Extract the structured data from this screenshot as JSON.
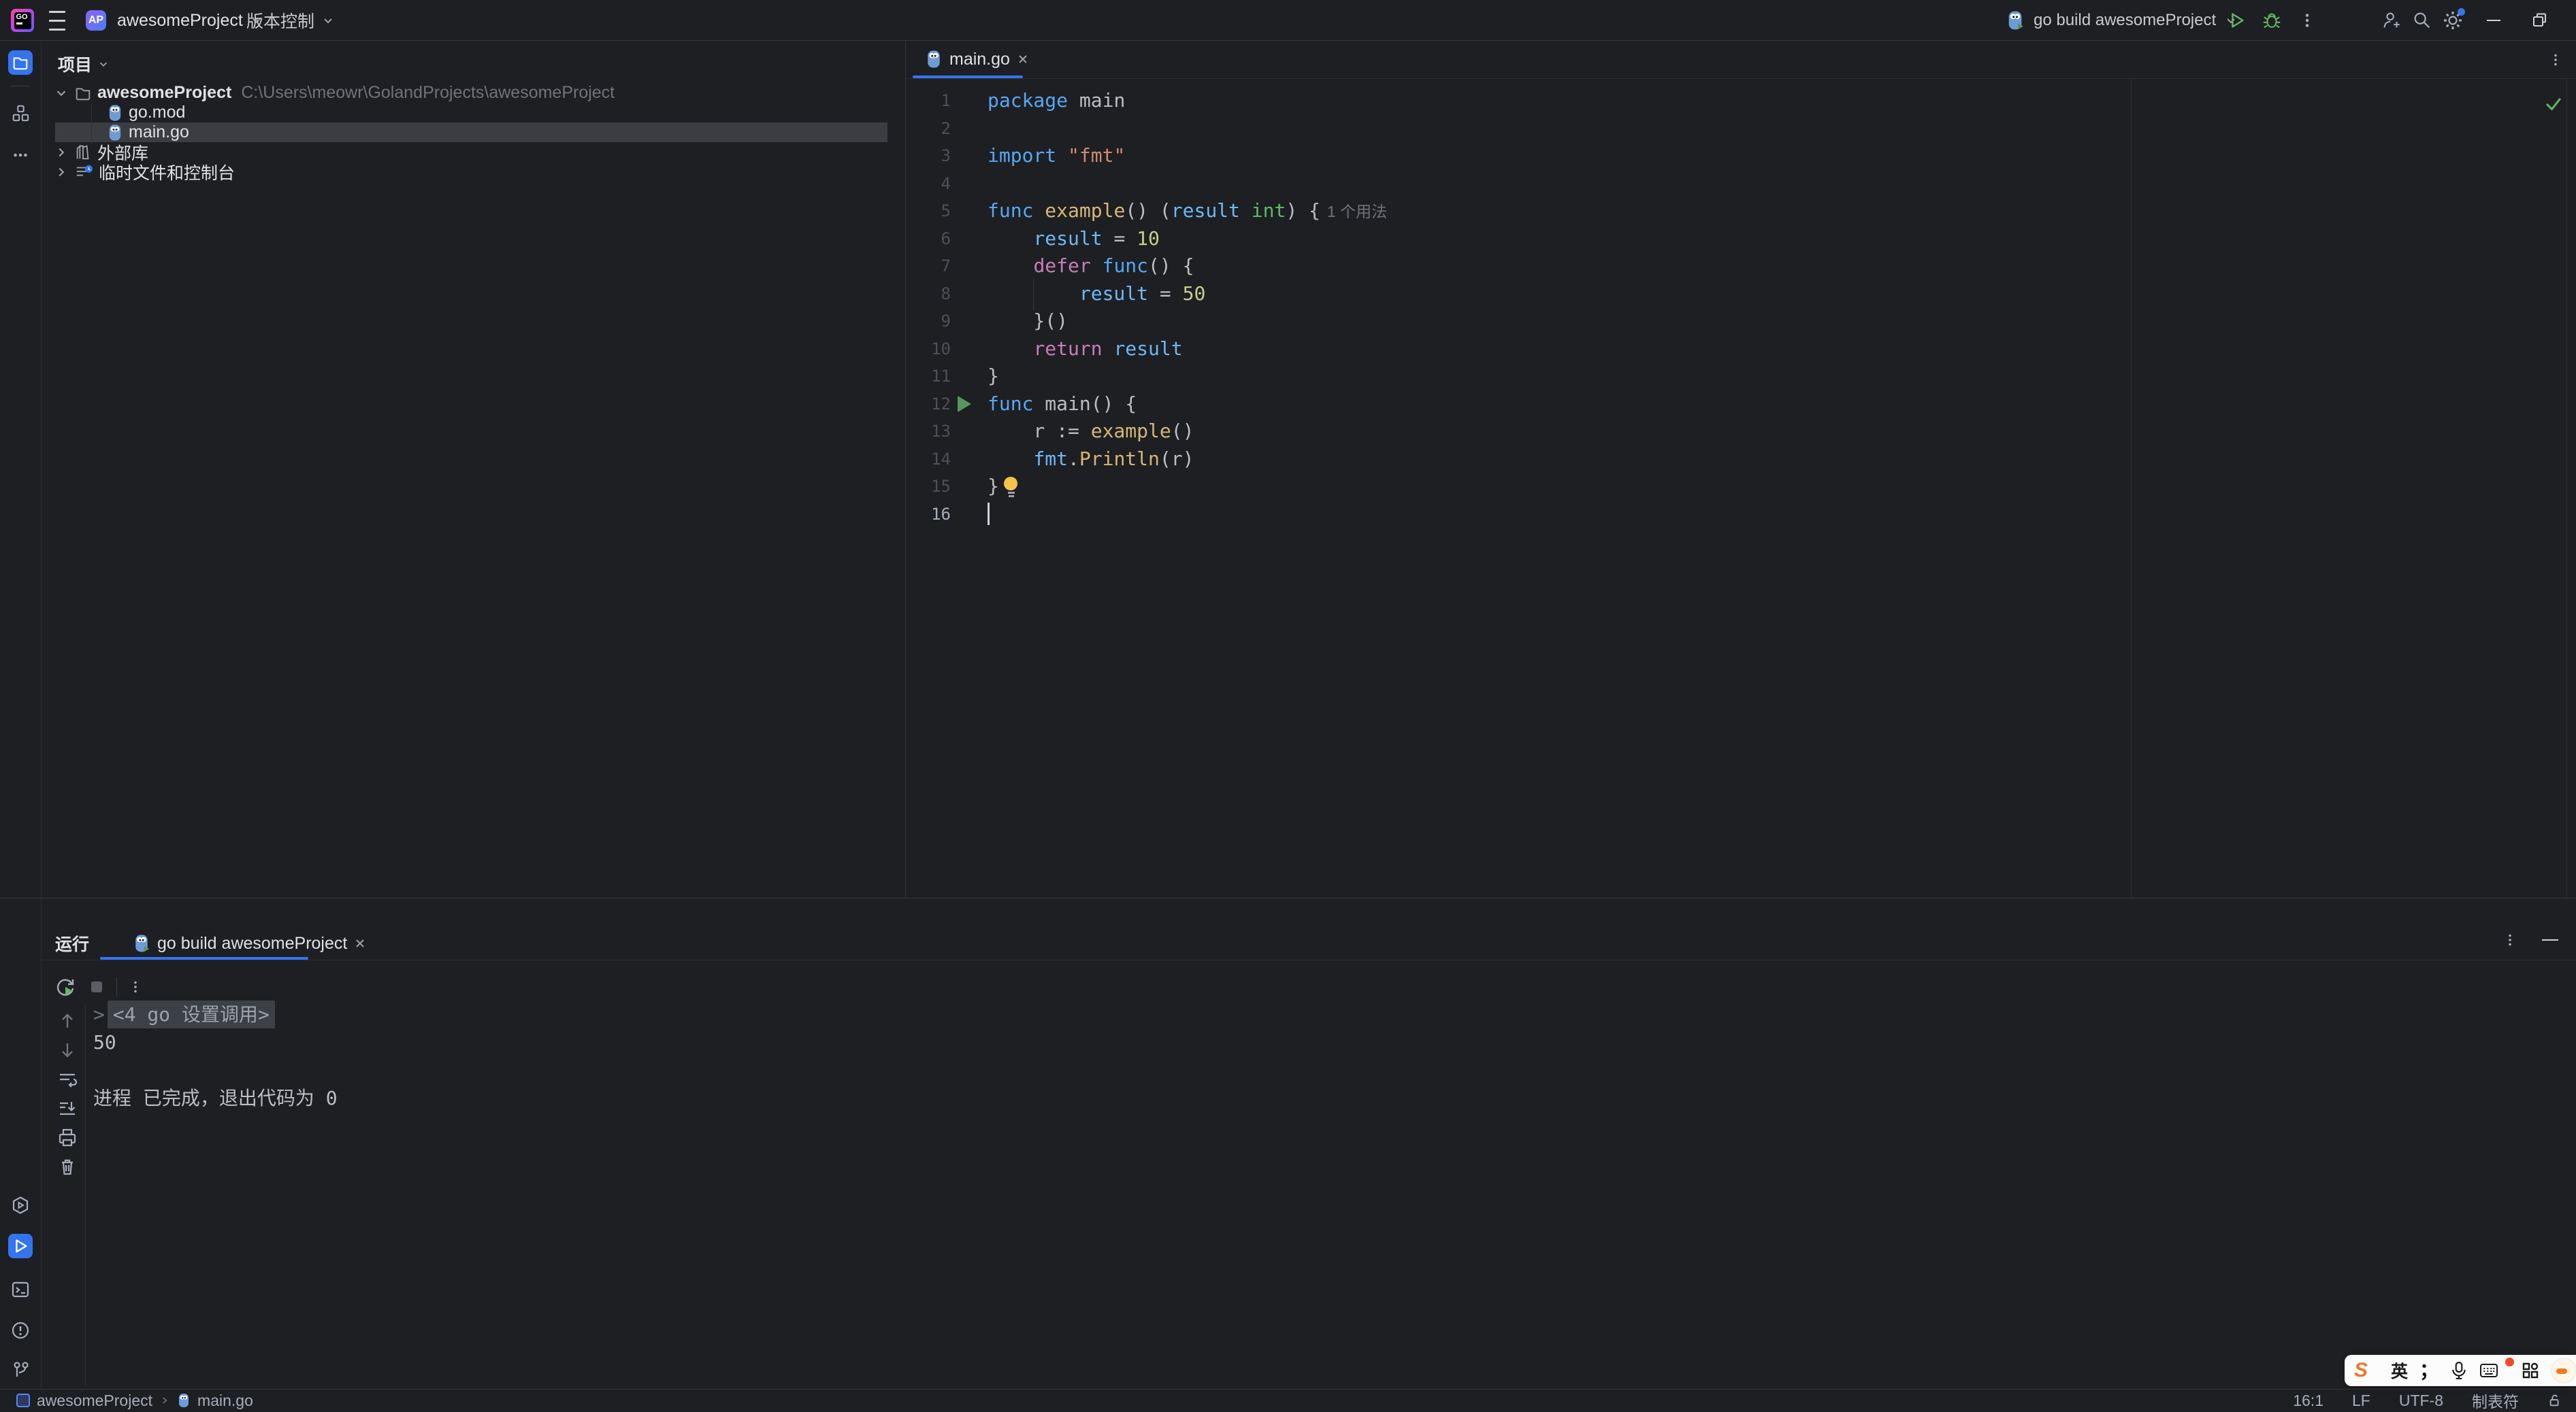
{
  "titlebar": {
    "logo_text": "GO",
    "avatar": "AP",
    "project_name": "awesomeProject",
    "vcs_label": "版本控制",
    "run_config": "go build awesomeProject"
  },
  "project_panel": {
    "header": "项目",
    "rows": [
      {
        "indent": 0,
        "chevron": "down",
        "icon": "folder",
        "label": "awesomeProject",
        "bold": true,
        "path": "C:\\Users\\meowr\\GolandProjects\\awesomeProject"
      },
      {
        "indent": 1,
        "icon": "gopher",
        "label": "go.mod"
      },
      {
        "indent": 1,
        "icon": "gopher",
        "label": "main.go",
        "selected": true
      },
      {
        "indent": 0,
        "chevron": "right",
        "icon": "library",
        "label": "外部库"
      },
      {
        "indent": 0,
        "chevron": "right",
        "icon": "scratch",
        "label": "临时文件和控制台"
      }
    ]
  },
  "editor": {
    "tab_label": "main.go",
    "lines": [
      {
        "n": "1",
        "tokens": [
          [
            "kw",
            "package"
          ],
          [
            "d",
            " main"
          ]
        ]
      },
      {
        "n": "2",
        "tokens": []
      },
      {
        "n": "3",
        "tokens": [
          [
            "kw",
            "import"
          ],
          [
            "d",
            " "
          ],
          [
            "str",
            "\"fmt\""
          ]
        ]
      },
      {
        "n": "4",
        "tokens": []
      },
      {
        "n": "5",
        "tokens": [
          [
            "kw",
            "func"
          ],
          [
            "d",
            " "
          ],
          [
            "fn",
            "example"
          ],
          [
            "d",
            "() ("
          ],
          [
            "var",
            "result"
          ],
          [
            "d",
            " "
          ],
          [
            "typ",
            "int"
          ],
          [
            "d",
            ") {"
          ],
          [
            "inlay",
            "1 个用法"
          ]
        ]
      },
      {
        "n": "6",
        "tokens": [
          [
            "d",
            "    "
          ],
          [
            "var",
            "result"
          ],
          [
            "d",
            " = "
          ],
          [
            "num",
            "10"
          ]
        ]
      },
      {
        "n": "7",
        "tokens": [
          [
            "d",
            "    "
          ],
          [
            "pink",
            "defer"
          ],
          [
            "d",
            " "
          ],
          [
            "kw",
            "func"
          ],
          [
            "d",
            "() {"
          ]
        ]
      },
      {
        "n": "8",
        "tokens": [
          [
            "d",
            "        "
          ],
          [
            "var",
            "result"
          ],
          [
            "d",
            " = "
          ],
          [
            "num",
            "50"
          ]
        ]
      },
      {
        "n": "9",
        "tokens": [
          [
            "d",
            "    }()"
          ]
        ]
      },
      {
        "n": "10",
        "tokens": [
          [
            "d",
            "    "
          ],
          [
            "pink",
            "return"
          ],
          [
            "d",
            " "
          ],
          [
            "var",
            "result"
          ]
        ]
      },
      {
        "n": "11",
        "tokens": [
          [
            "d",
            "}"
          ]
        ]
      },
      {
        "n": "12",
        "run": true,
        "tokens": [
          [
            "kw",
            "func"
          ],
          [
            "d",
            " main() {"
          ]
        ]
      },
      {
        "n": "13",
        "tokens": [
          [
            "d",
            "    r := "
          ],
          [
            "fn",
            "example"
          ],
          [
            "d",
            "()"
          ]
        ]
      },
      {
        "n": "14",
        "tokens": [
          [
            "d",
            "    "
          ],
          [
            "var",
            "fmt"
          ],
          [
            "d",
            "."
          ],
          [
            "fn",
            "Println"
          ],
          [
            "d",
            "(r)"
          ]
        ]
      },
      {
        "n": "15",
        "bulb": true,
        "tokens": [
          [
            "d",
            "}"
          ]
        ]
      },
      {
        "n": "16",
        "caret": true,
        "current": true,
        "tokens": []
      }
    ]
  },
  "run_panel": {
    "title": "运行",
    "tab_label": "go build awesomeProject",
    "console": [
      {
        "type": "fold",
        "prefix": ">",
        "text": "<4 go 设置调用>"
      },
      {
        "type": "plain",
        "text": "50"
      },
      {
        "type": "blank",
        "text": ""
      },
      {
        "type": "plain",
        "text": "进程 已完成，退出代码为 0"
      }
    ]
  },
  "status_bar": {
    "project": "awesomeProject",
    "file": "main.go",
    "items": [
      "16:1",
      "LF",
      "UTF-8",
      "制表符"
    ]
  },
  "ime": {
    "logo": "S",
    "lang": "英",
    "punct": "；"
  },
  "colors": {
    "accent": "#3574F0",
    "run_green": "#57965C",
    "error_none_check": "#5FAD65"
  }
}
